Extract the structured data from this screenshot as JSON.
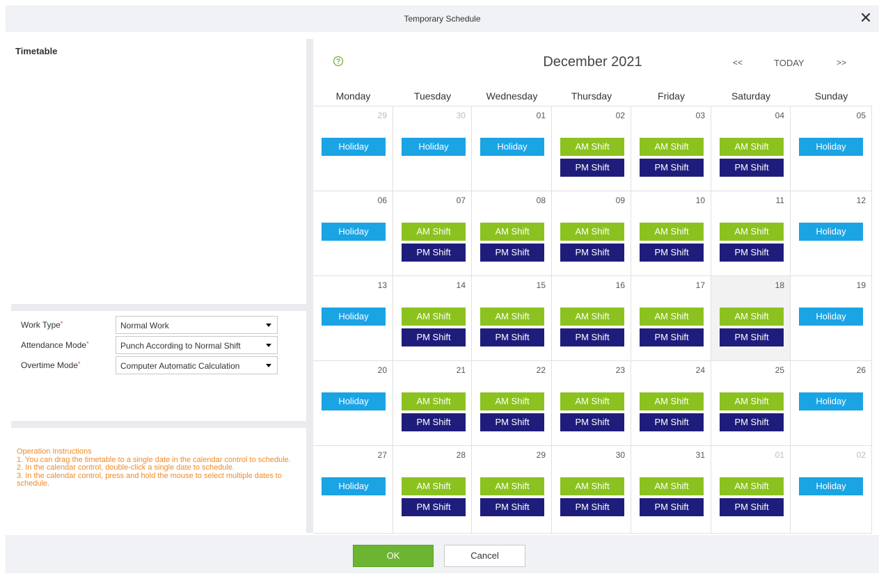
{
  "window": {
    "title": "Temporary Schedule"
  },
  "left": {
    "timetable_title": "Timetable",
    "form": [
      {
        "label": "Work Type",
        "required_mark": "*",
        "value": "Normal Work"
      },
      {
        "label": "Attendance Mode",
        "required_mark": "*",
        "value": "Punch According to Normal Shift"
      },
      {
        "label": "Overtime Mode",
        "required_mark": "*",
        "value": "Computer Automatic Calculation"
      }
    ],
    "instructions": [
      "Operation Instructions",
      "1. You can drag the timetable to a single date in the calendar control to schedule.",
      "2. In the calendar control, double-click a single date to schedule.",
      "3. In the calendar control, press and hold the mouse to select multiple dates to schedule."
    ]
  },
  "calendar": {
    "month_title": "December 2021",
    "nav": {
      "prev": "<<",
      "today": "TODAY",
      "next": ">>"
    },
    "weekdays": [
      "Monday",
      "Tuesday",
      "Wednesday",
      "Thursday",
      "Friday",
      "Saturday",
      "Sunday"
    ],
    "labels": {
      "holiday": "Holiday",
      "am": "AM Shift",
      "pm": "PM Shift"
    },
    "colors": {
      "holiday": "#1aa4e4",
      "am": "#8cc21f",
      "pm": "#1f1d7b",
      "ok": "#6cb533",
      "instructions": "#f08a24"
    },
    "highlighted_day": "18",
    "weeks": [
      [
        {
          "d": "29",
          "other": true,
          "t": "holiday"
        },
        {
          "d": "30",
          "other": true,
          "t": "holiday"
        },
        {
          "d": "01",
          "t": "holiday"
        },
        {
          "d": "02",
          "t": "shift"
        },
        {
          "d": "03",
          "t": "shift"
        },
        {
          "d": "04",
          "t": "shift"
        },
        {
          "d": "05",
          "t": "holiday"
        }
      ],
      [
        {
          "d": "06",
          "t": "holiday"
        },
        {
          "d": "07",
          "t": "shift"
        },
        {
          "d": "08",
          "t": "shift"
        },
        {
          "d": "09",
          "t": "shift"
        },
        {
          "d": "10",
          "t": "shift"
        },
        {
          "d": "11",
          "t": "shift"
        },
        {
          "d": "12",
          "t": "holiday"
        }
      ],
      [
        {
          "d": "13",
          "t": "holiday"
        },
        {
          "d": "14",
          "t": "shift"
        },
        {
          "d": "15",
          "t": "shift"
        },
        {
          "d": "16",
          "t": "shift"
        },
        {
          "d": "17",
          "t": "shift"
        },
        {
          "d": "18",
          "t": "shift"
        },
        {
          "d": "19",
          "t": "holiday"
        }
      ],
      [
        {
          "d": "20",
          "t": "holiday"
        },
        {
          "d": "21",
          "t": "shift"
        },
        {
          "d": "22",
          "t": "shift"
        },
        {
          "d": "23",
          "t": "shift"
        },
        {
          "d": "24",
          "t": "shift"
        },
        {
          "d": "25",
          "t": "shift"
        },
        {
          "d": "26",
          "t": "holiday"
        }
      ],
      [
        {
          "d": "27",
          "t": "holiday"
        },
        {
          "d": "28",
          "t": "shift"
        },
        {
          "d": "29",
          "t": "shift"
        },
        {
          "d": "30",
          "t": "shift"
        },
        {
          "d": "31",
          "t": "shift"
        },
        {
          "d": "01",
          "other": true,
          "t": "shift"
        },
        {
          "d": "02",
          "other": true,
          "t": "holiday"
        }
      ]
    ]
  },
  "footer": {
    "ok_label": "OK",
    "cancel_label": "Cancel"
  }
}
